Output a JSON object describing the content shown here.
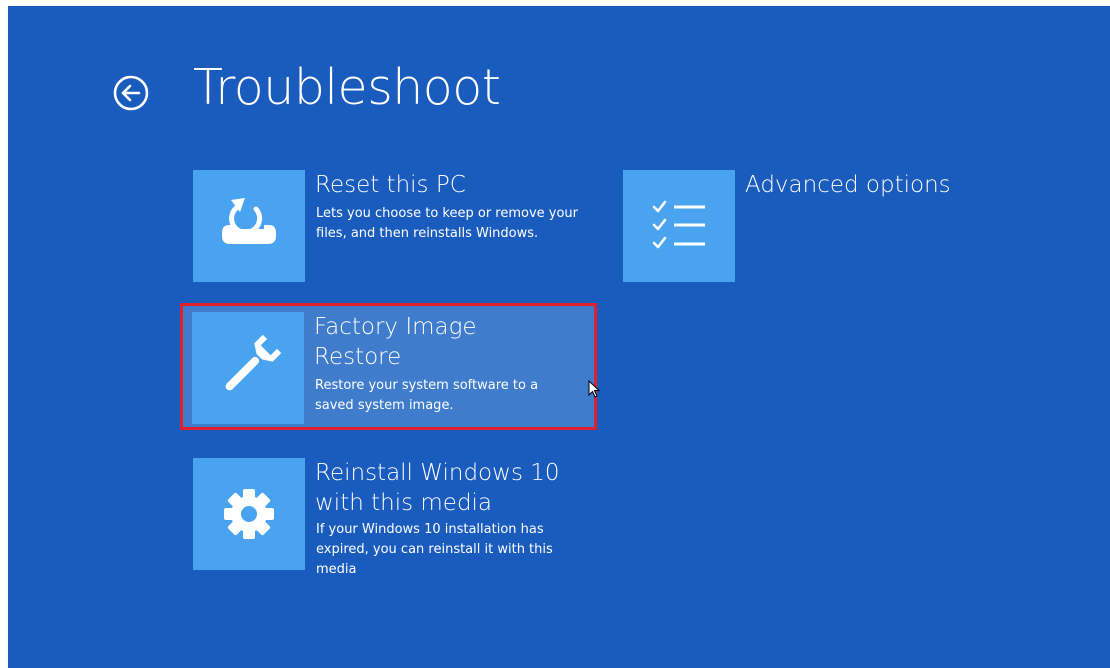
{
  "screen": {
    "title": "Troubleshoot",
    "background_color": "#1a5bbe",
    "tile_color": "#4aa3ee",
    "highlight_color": "#e0202c"
  },
  "tiles": [
    {
      "title": "Reset this PC",
      "description": "Lets you choose to keep or remove your files, and then reinstalls Windows.",
      "icon": "reset-disk-icon"
    },
    {
      "title": "Advanced options",
      "description": "",
      "icon": "checklist-icon"
    },
    {
      "title": "Factory Image Restore",
      "description": "Restore your system software to a saved system image.",
      "icon": "wrench-icon",
      "selected": true
    },
    {
      "title": "Reinstall Windows 10 with this media",
      "description": "If your Windows 10 installation has expired, you can reinstall it with this media",
      "icon": "gear-icon"
    }
  ]
}
